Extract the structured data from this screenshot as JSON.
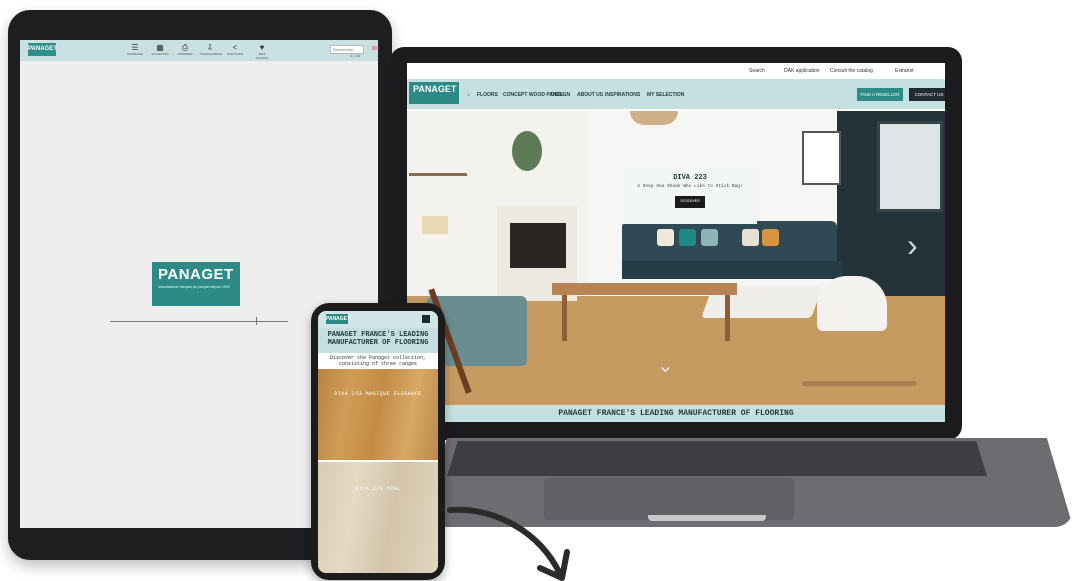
{
  "tablet": {
    "logo": "PANAGET",
    "toolbar": [
      "SOMMAIRE",
      "VIGNETTES",
      "IMPRIMER",
      "TELECHARGER",
      "PARTAGER",
      "MES FAVORIS"
    ],
    "search_placeholder": "Rechercher",
    "page_indicator": "1 | 44",
    "splash_brand": "PANAGET",
    "splash_tagline": "manufacturer français de parquet depuis 1949"
  },
  "laptop": {
    "top_links": [
      "Search",
      "DAK application",
      "Consult the catalog",
      "Extranet"
    ],
    "logo": "PANAGET",
    "nav": [
      "FLOORS",
      "CONCEPT WOOD PANEL",
      "DESIGN",
      "ABOUT US",
      "INSPIRATIONS",
      "MY SELECTION"
    ],
    "find_button": "FIND A RESELLER",
    "contact_button": "CONTACT US",
    "promo_title": "DIVA 223",
    "promo_subtitle": "A Deep Sea Shade Who Like to Stick Bag!",
    "promo_button": "DISCOVER",
    "band_title": "PANAGET FRANCE'S LEADING MANUFACTURER OF FLOORING"
  },
  "phone": {
    "logo": "PANAGET",
    "heading": "PANAGET FRANCE'S LEADING MANUFACTURER OF FLOORING",
    "intro": "Discover the Panaget collection, consisting of three ranges",
    "wood1_label": "DIVA 233 MAGIQUE ELEGANCE",
    "wood2_label": "DIVA 233 OPAL"
  },
  "colors": {
    "brand_teal": "#2e8a86",
    "light_teal": "#c5e0e1",
    "device_dark": "#1c1c1e"
  }
}
